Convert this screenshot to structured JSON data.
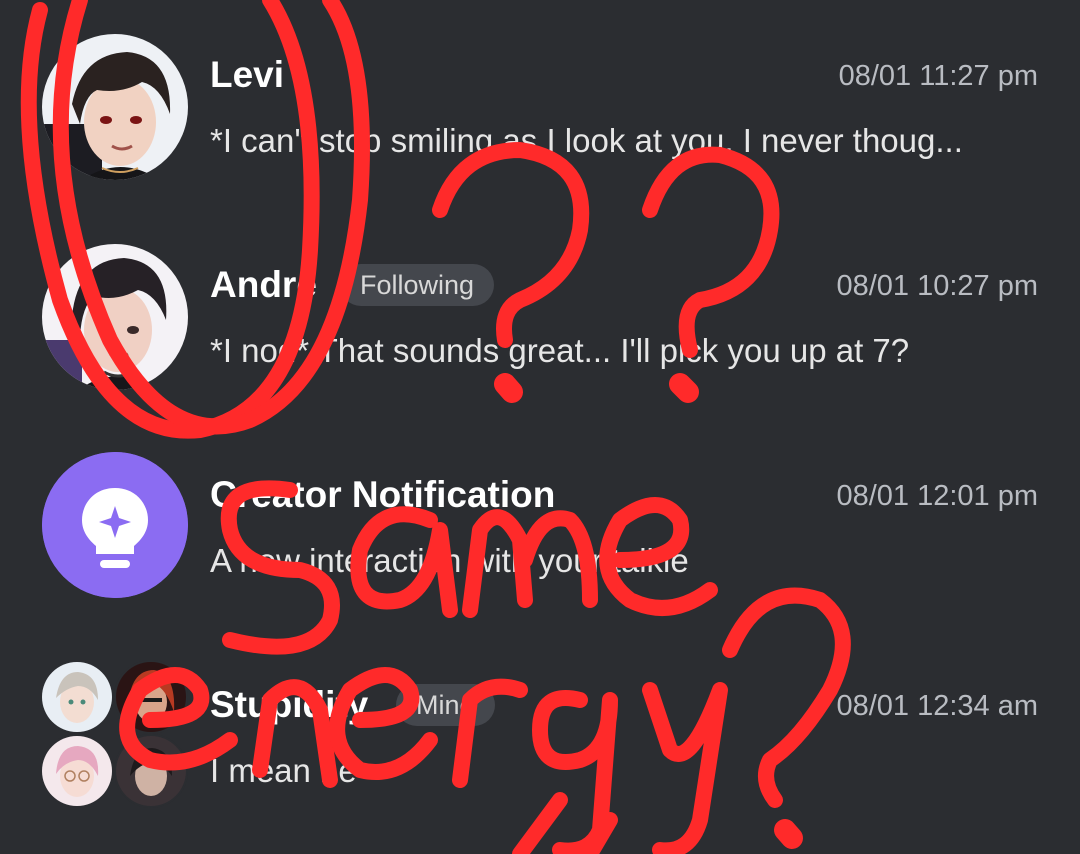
{
  "chats": [
    {
      "name": "Levi",
      "time": "08/01 11:27 pm",
      "preview": "*I can't stop smiling as I look at you, I never thoug...",
      "avatar": "anime-man-avatar-levi"
    },
    {
      "name": "Andre",
      "badge": "Following",
      "time": "08/01 10:27 pm",
      "preview": "*I nod* That sounds great... I'll pick you up at 7?",
      "avatar": "anime-man-avatar-andre"
    },
    {
      "name": "Creator Notification",
      "time": "08/01 12:01 pm",
      "preview": "A new interaction with your talkie",
      "avatar": "lightbulb-sparkle-icon"
    },
    {
      "name": "Stupidity",
      "badge": "Mine",
      "time": "08/01 12:34 am",
      "preview": "I mean he",
      "avatar": "group-avatar"
    }
  ],
  "annotation": {
    "handwritten_text": "same energy?",
    "marks": "??",
    "color": "#ff2a2a"
  },
  "colors": {
    "background": "#2b2d31",
    "notification_purple": "#8b6cf2",
    "badge_bg": "#44474d",
    "time_text": "#b9bcc2"
  }
}
